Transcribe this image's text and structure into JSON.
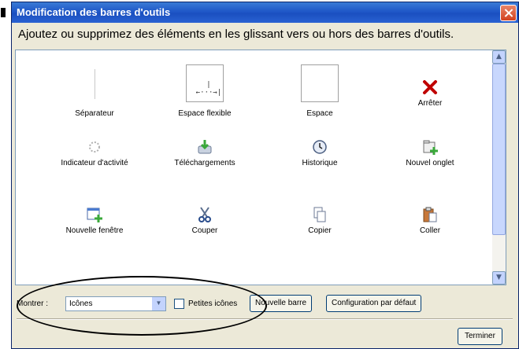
{
  "window": {
    "title": "Modification des barres d'outils"
  },
  "instructions": "Ajoutez ou supprimez des éléments en les glissant vers ou hors des barres d'outils.",
  "palette_items": [
    {
      "label": "Séparateur",
      "icon": "separator-icon"
    },
    {
      "label": "Espace flexible",
      "icon": "flexible-space-icon"
    },
    {
      "label": "Espace",
      "icon": "space-icon"
    },
    {
      "label": "Arrêter",
      "icon": "stop-icon"
    },
    {
      "label": "Indicateur d'activité",
      "icon": "activity-indicator-icon"
    },
    {
      "label": "Téléchargements",
      "icon": "downloads-icon"
    },
    {
      "label": "Historique",
      "icon": "history-icon"
    },
    {
      "label": "Nouvel onglet",
      "icon": "new-tab-icon"
    },
    {
      "label": "Nouvelle fenêtre",
      "icon": "new-window-icon"
    },
    {
      "label": "Couper",
      "icon": "cut-icon"
    },
    {
      "label": "Copier",
      "icon": "copy-icon"
    },
    {
      "label": "Coller",
      "icon": "paste-icon"
    }
  ],
  "controls": {
    "show_label": "Montrer :",
    "show_value": "Icônes",
    "small_icons_label": "Petites icônes",
    "small_icons_checked": false,
    "new_toolbar_label": "Nouvelle barre",
    "restore_default_label": "Configuration par défaut",
    "done_label": "Terminer"
  },
  "colors": {
    "titlebar": "#1f57c8",
    "dialog_bg": "#ece9d8",
    "stop_red": "#c00000",
    "add_green": "#3aa83a"
  }
}
